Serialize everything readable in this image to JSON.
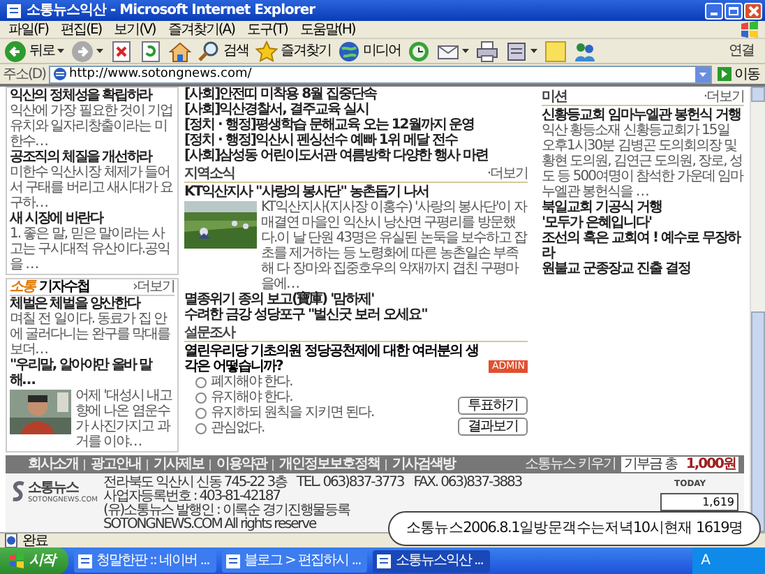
{
  "window": {
    "title": "소통뉴스익산 - Microsoft Internet Explorer"
  },
  "menu": [
    "파일(F)",
    "편집(E)",
    "보기(V)",
    "즐겨찾기(A)",
    "도구(T)",
    "도움말(H)"
  ],
  "toolbar": [
    {
      "kind": "back",
      "label": "뒤로"
    },
    {
      "kind": "forward"
    },
    {
      "kind": "stop"
    },
    {
      "kind": "refresh"
    },
    {
      "kind": "home"
    },
    {
      "kind": "search",
      "label": "검색"
    },
    {
      "kind": "favorites",
      "label": "즐겨찾기"
    },
    {
      "kind": "media",
      "label": "미디어"
    },
    {
      "kind": "history"
    },
    {
      "kind": "mail"
    },
    {
      "kind": "print"
    },
    {
      "kind": "edit"
    },
    {
      "kind": "note"
    },
    {
      "kind": "messenger"
    }
  ],
  "links_label": "연결",
  "address": {
    "label": "주소(D)",
    "value": "http://www.sotongnews.com/",
    "go": "이동"
  },
  "columns": [
    {
      "title": "익산의 정체성을 확립하라",
      "summary": "익산에 가장 필요한 것이 기업유치와 일자리창출이라는 미한수…"
    },
    {
      "title": "공조직의 체질을 개선하라",
      "summary": "미한수 익산시장 체제가 들어서 구태를 버리고 새시대가 요구하…"
    },
    {
      "title": "새 시장에 바란다",
      "summary": "1. 좋은 말, 믿은 말이라는 사고는 구시대적 유산이다.공익을 …"
    }
  ],
  "reporter_notes": {
    "logo": "소통",
    "title": "기자수첩",
    "more": "›더보기",
    "items": [
      {
        "kind": "text",
        "title": "체벌은 체벌을 양산한다",
        "summary": "며칠 전 일이다. 동료가 집 안에 굴러다니는 완구를 막대를 보더…"
      },
      {
        "title": "\"우리말, 알아야만 올바 말해…",
        "summary": "어제 '대성시 내고 향에 나온 염운수가 사진가지고 과거를 이야…"
      }
    ]
  },
  "headlines": [
    "[사회]안전띠 미착용 8월 집중단속",
    "[사회]익산경찰서, 결주교육 실시",
    "[정치 · 행정]평생학습 문해교육 오는 12월까지 운영",
    "[정치 · 행정]익산시 펜싱선수 예빠 1위 메달 전수",
    "[사회]삼성동 어린이도서관 여름방학 다양한 행사 마련"
  ],
  "local_news": {
    "title": "지역소식",
    "more": "·더보기",
    "lead": {
      "title": "KT익산지사 \"사랑의 봉사단\" 농촌돕기 나서",
      "summary": "KT익산지사(지사장 이홍수) '사랑의 봉사단'이 자매결연 마을인 익산시 낭산면 구평리를 방문했다.이 날 단원 43명은 유실된 논둑을 보수하고 잡초를 제거하는 등 노령화에 따른 농촌일손 부족해 다 장마와 집중호우의 악재까지 겹친 구평마을에…"
    },
    "items": [
      "멸종위기 종의 보고(寶庫) '맘하제'",
      "수려한 금강 성당포구 \"벌신굿 보러 오세요\""
    ]
  },
  "poll": {
    "title": "설문조사",
    "question": "열린우리당 기초의원 정당공천제에 대한 여러분의 생각은 어떻습니까?",
    "badge": "ADMIN",
    "options": [
      {
        "label": "폐지해야 한다.",
        "selected": false
      },
      {
        "label": "유지해야 한다.",
        "selected": false
      },
      {
        "label": "유지하되 원칙을 지키면 된다.",
        "selected": false
      },
      {
        "label": "관심없다.",
        "selected": false
      }
    ],
    "buttons": [
      "투표하기",
      "결과보기"
    ]
  },
  "mission": {
    "title": "미션",
    "more": "·더보기",
    "lead": {
      "title": "신황등교회 임마누엘관 봉헌식 거행",
      "summary": "익산 황등소재 신황등교회가 15일 오후1시30분 김병곤 도의회의장 및 황현 도의원, 김연근 도의원, 장로, 성도 등 500여명이 참석한 가운데 임마누엘관 봉헌식을 …"
    },
    "items": [
      "북일교회 기공식 거행",
      "'모두가 은혜입니다'",
      "조선의 혹은 교회여 ! 예수로 무장하라",
      "원불교 군종장교 진출 결정"
    ]
  },
  "footer": {
    "links": [
      "회사소개",
      "광고안내",
      "기사제보",
      "이용약관",
      "개인정보보호정책",
      "기사검색방"
    ],
    "donation": {
      "label": "소통뉴스 키우기",
      "field": "기부금 총",
      "amount": "1,000원"
    },
    "logo": {
      "name": "소통뉴스",
      "domain": "SOTONGNEWS.COM"
    },
    "info": [
      {
        "parts": [
          "전라북도 익산시 신동 745-22 3층",
          "TEL. 063)837-3773",
          "FAX. 063)837-3883",
          "사업자등록번호 : 403-81-42187"
        ]
      },
      {
        "parts": [
          "(유)소통뉴스 발행인 : 이록순 경기진행물등록"
        ]
      },
      {
        "parts": [
          "SOTONGNEWS.COM All rights reserve"
        ]
      }
    ],
    "today": {
      "label": "TODAY",
      "count": "1,619"
    }
  },
  "status_bar": {
    "text": "완료"
  },
  "taskbar": {
    "start": "시작",
    "tasks": [
      {
        "label": "청말한판 :: 네이버 ...",
        "selected": false
      },
      {
        "label": "블로그 > 편집하시 ...",
        "selected": false
      },
      {
        "label": "소통뉴스익산 ...",
        "selected": true
      }
    ],
    "tray": [
      "A"
    ]
  },
  "callout": "소통뉴스2006.8.1일방문객수는저녁10시현재 1619명"
}
